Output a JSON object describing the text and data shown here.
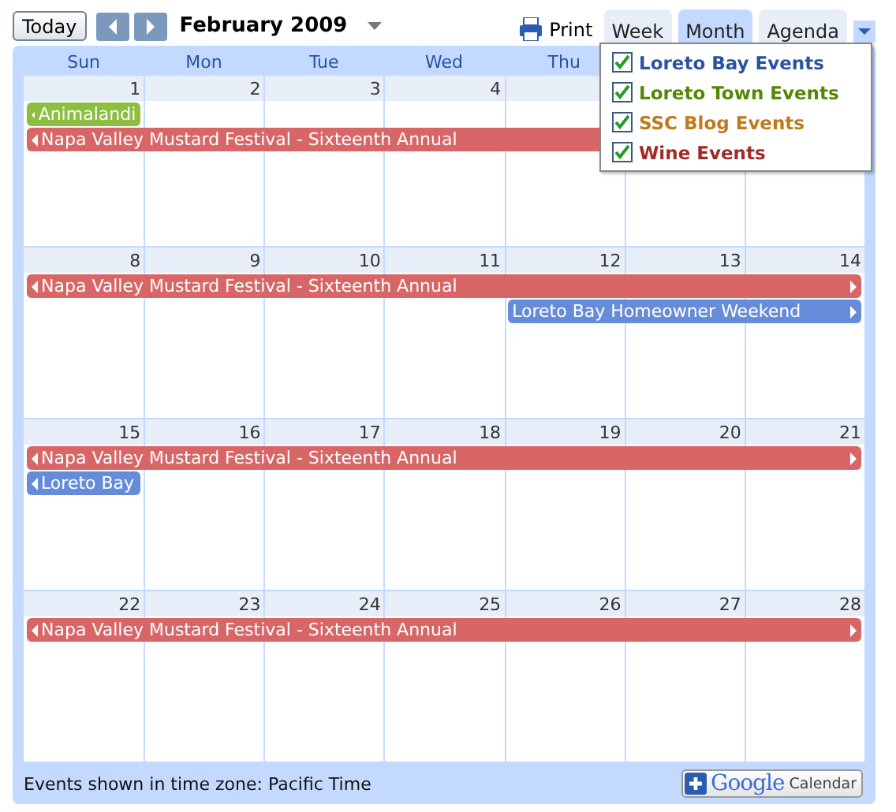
{
  "toolbar": {
    "today": "Today",
    "month_title": "February 2009",
    "print": "Print",
    "views": [
      {
        "label": "Week",
        "selected": false
      },
      {
        "label": "Month",
        "selected": true
      },
      {
        "label": "Agenda",
        "selected": false
      }
    ]
  },
  "day_headers": [
    "Sun",
    "Mon",
    "Tue",
    "Wed",
    "Thu"
  ],
  "weeks": [
    {
      "days": [
        "1",
        "2",
        "3",
        "4"
      ],
      "events": [
        {
          "title": "Animalandi",
          "color": "#8cbf40",
          "continues_before": true,
          "continues_after": false
        },
        {
          "title": "Napa Valley Mustard Festival - Sixteenth Annual",
          "color": "#d96666",
          "continues_before": true,
          "continues_after": false
        }
      ]
    },
    {
      "days": [
        "8",
        "9",
        "10",
        "11",
        "12",
        "13",
        "14"
      ],
      "events": [
        {
          "title": "Napa Valley Mustard Festival - Sixteenth Annual",
          "color": "#d96666",
          "continues_before": true,
          "continues_after": true
        },
        {
          "title": "Loreto Bay Homeowner Weekend",
          "color": "#668cd9",
          "continues_before": false,
          "continues_after": true
        }
      ]
    },
    {
      "days": [
        "15",
        "16",
        "17",
        "18",
        "19",
        "20",
        "21"
      ],
      "events": [
        {
          "title": "Napa Valley Mustard Festival - Sixteenth Annual",
          "color": "#d96666",
          "continues_before": true,
          "continues_after": true
        },
        {
          "title": "Loreto Bay",
          "color": "#668cd9",
          "continues_before": true,
          "continues_after": false
        }
      ]
    },
    {
      "days": [
        "22",
        "23",
        "24",
        "25",
        "26",
        "27",
        "28"
      ],
      "events": [
        {
          "title": "Napa Valley Mustard Festival - Sixteenth Annual",
          "color": "#d96666",
          "continues_before": true,
          "continues_after": true
        }
      ]
    }
  ],
  "calendars_menu": [
    {
      "label": "Loreto Bay Events",
      "checked": true,
      "color": "#2952a3"
    },
    {
      "label": "Loreto Town Events",
      "checked": true,
      "color": "#528800"
    },
    {
      "label": "SSC Blog Events",
      "checked": true,
      "color": "#c07a1a"
    },
    {
      "label": "Wine Events",
      "checked": true,
      "color": "#a32929"
    }
  ],
  "footer": {
    "timezone_note": "Events shown in time zone: Pacific Time",
    "badge_brand": "Google",
    "badge_label": "Calendar"
  }
}
